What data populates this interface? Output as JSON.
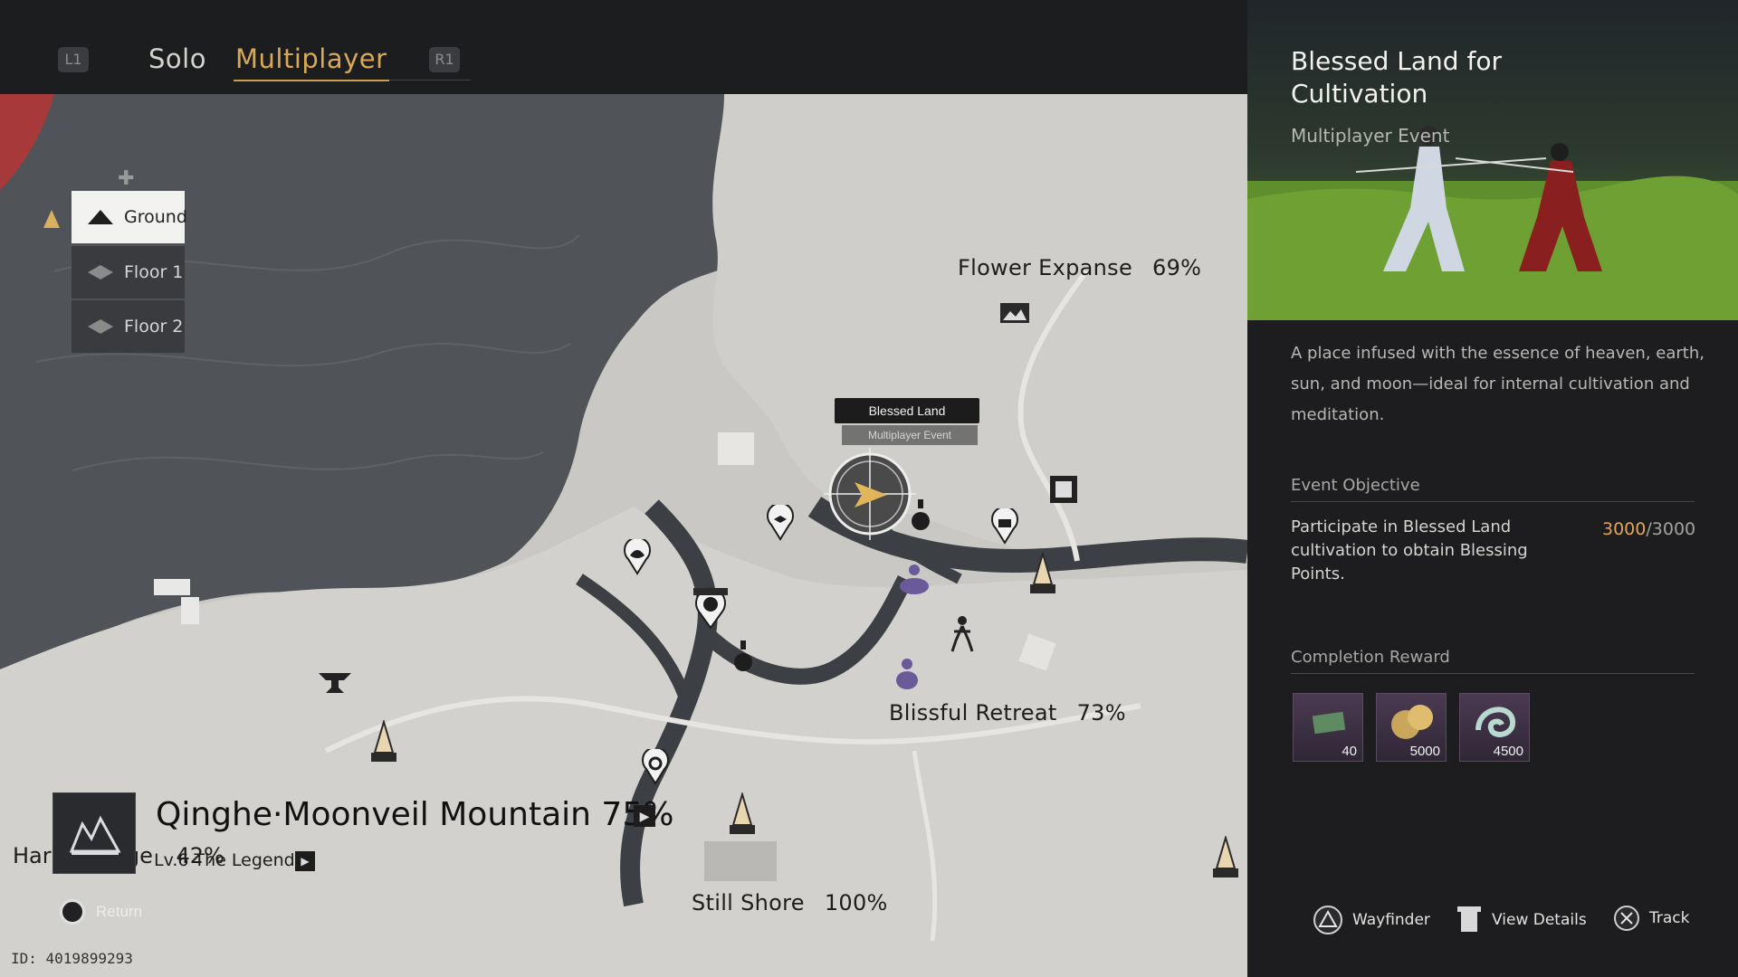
{
  "header": {
    "left_shoulder": "L1",
    "right_shoulder": "R1",
    "tabs": [
      {
        "label": "Solo",
        "active": false
      },
      {
        "label": "Multiplayer",
        "active": true
      }
    ],
    "accent_color": "#d9a956"
  },
  "floors": {
    "items": [
      {
        "label": "Ground",
        "selected": true
      },
      {
        "label": "Floor 1",
        "selected": false
      },
      {
        "label": "Floor 2",
        "selected": false
      }
    ]
  },
  "map": {
    "regions": [
      {
        "name": "Flower Expanse",
        "percent": "69%"
      },
      {
        "name": "Blissful Retreat",
        "percent": "73%"
      },
      {
        "name": "Still Shore",
        "percent": "100%"
      }
    ],
    "selected_marker": {
      "title": "Blessed Land",
      "subtitle": "Multiplayer Event"
    },
    "village_label": "Har… Village",
    "village_percent": "42%"
  },
  "region_info": {
    "name": "Qinghe·Moonveil Mountain",
    "percent": "75%",
    "level": "Lv.6 The Legend"
  },
  "footer": {
    "return_label": "Return",
    "id_text": "ID: 4019899293"
  },
  "panel": {
    "title": "Blessed Land for Cultivation",
    "subtitle": "Multiplayer Event",
    "description": "A place infused with the essence of heaven, earth, sun, and moon—ideal for internal cultivation and meditation.",
    "objective_heading": "Event Objective",
    "objective_text": "Participate in Blessed Land cultivation to obtain Blessing Points.",
    "objective_current": "3000",
    "objective_total": "/3000",
    "reward_heading": "Completion Reward",
    "rewards": [
      {
        "icon": "map-scroll-icon",
        "qty": "40"
      },
      {
        "icon": "coins-icon",
        "qty": "5000"
      },
      {
        "icon": "jade-swirl-icon",
        "qty": "4500"
      }
    ],
    "actions": [
      {
        "icon": "triangle-button-icon",
        "label": "Wayfinder"
      },
      {
        "icon": "details-icon",
        "label": "View Details"
      },
      {
        "icon": "cross-button-icon",
        "label": "Track"
      }
    ]
  }
}
